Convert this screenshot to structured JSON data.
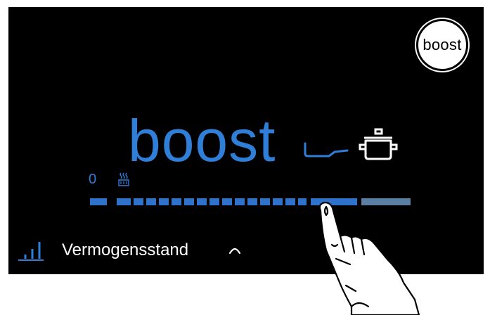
{
  "boost_button": {
    "label": "boost"
  },
  "power_display": {
    "level": "boost"
  },
  "slider": {
    "zero_label": "0",
    "selected_fraction": 0.82,
    "active_color": "#2e73c9",
    "boost_color": "#5a7fa3"
  },
  "footer": {
    "label": "Vermogensstand"
  },
  "icons": {
    "pan": "frying-pan-icon",
    "pot": "pot-icon",
    "keep_warm": "keep-warm-icon",
    "power_chart": "power-level-icon",
    "caret": "caret-up-icon",
    "hand": "pointing-hand-icon"
  },
  "colors": {
    "accent": "#2f7ed8",
    "background": "#000000"
  }
}
